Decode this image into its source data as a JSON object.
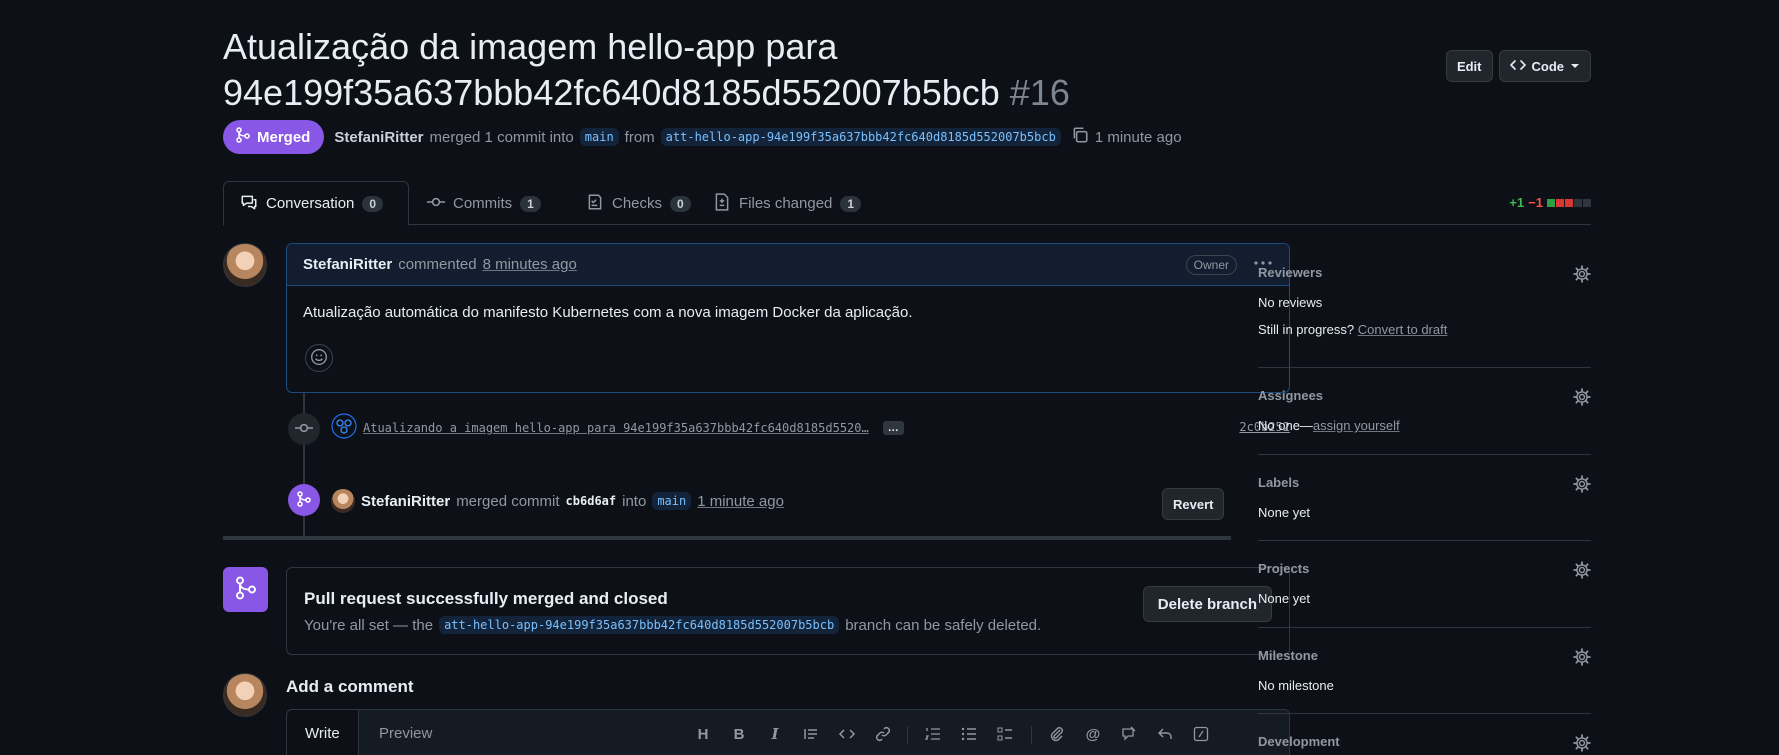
{
  "pr": {
    "title_line1": "Atualização da imagem hello-app para",
    "title_line2": "94e199f35a637bbb42fc640d8185d552007b5bcb",
    "number": "#16",
    "edit_label": "Edit",
    "code_label": "Code",
    "state": "Merged",
    "author": "StefaniRitter",
    "merged_text": "merged 1 commit into",
    "base_branch": "main",
    "from_text": "from",
    "head_branch": "att-hello-app-94e199f35a637bbb42fc640d8185d552007b5bcb",
    "time": "1 minute ago"
  },
  "tabs": [
    {
      "label": "Conversation",
      "count": "0",
      "icon": "comment-icon"
    },
    {
      "label": "Commits",
      "count": "1",
      "icon": "commit-icon"
    },
    {
      "label": "Checks",
      "count": "0",
      "icon": "checklist-icon"
    },
    {
      "label": "Files changed",
      "count": "1",
      "icon": "file-diff-icon"
    }
  ],
  "diffstat": {
    "additions": "+1",
    "deletions": "−1",
    "colors": [
      "#2ea043",
      "#da3633",
      "#da3633",
      "#30363d",
      "#30363d"
    ]
  },
  "comment": {
    "author": "StefaniRitter",
    "action": "commented",
    "time": "8 minutes ago",
    "role": "Owner",
    "body": "Atualização automática do manifesto Kubernetes com a nova imagem Docker da aplicação."
  },
  "commit_event": {
    "message": "Atualizando a imagem hello-app para 94e199f35a637bbb42fc640d8185d5520…",
    "ellipsis": "…",
    "sha": "2c0b252"
  },
  "merge_event": {
    "author": "StefaniRitter",
    "text": "merged commit",
    "sha": "cb6d6af",
    "into": "into",
    "branch": "main",
    "time": "1 minute ago",
    "revert_label": "Revert"
  },
  "merge_box": {
    "title": "Pull request successfully merged and closed",
    "sub_before": "You're all set — the",
    "branch": "att-hello-app-94e199f35a637bbb42fc640d8185d552007b5bcb",
    "sub_after": "branch can be safely deleted.",
    "delete_label": "Delete branch"
  },
  "add_comment": {
    "title": "Add a comment",
    "write_tab": "Write",
    "preview_tab": "Preview",
    "tools": [
      "heading-icon",
      "bold-icon",
      "italic-icon",
      "quote-icon",
      "code-icon",
      "link-icon",
      "ordered-list-icon",
      "unordered-list-icon",
      "task-list-icon",
      "attach-icon",
      "mention-icon",
      "reference-icon",
      "reply-icon",
      "slash-command-icon"
    ]
  },
  "sidebar": {
    "reviewers": {
      "title": "Reviewers",
      "value": "No reviews",
      "extra": "Still in progress?",
      "extra_link": "Convert to draft"
    },
    "assignees": {
      "title": "Assignees",
      "value": "No one—",
      "link": "assign yourself"
    },
    "labels": {
      "title": "Labels",
      "value": "None yet"
    },
    "projects": {
      "title": "Projects",
      "value": "None yet"
    },
    "milestone": {
      "title": "Milestone",
      "value": "No milestone"
    },
    "development": {
      "title": "Development"
    }
  }
}
